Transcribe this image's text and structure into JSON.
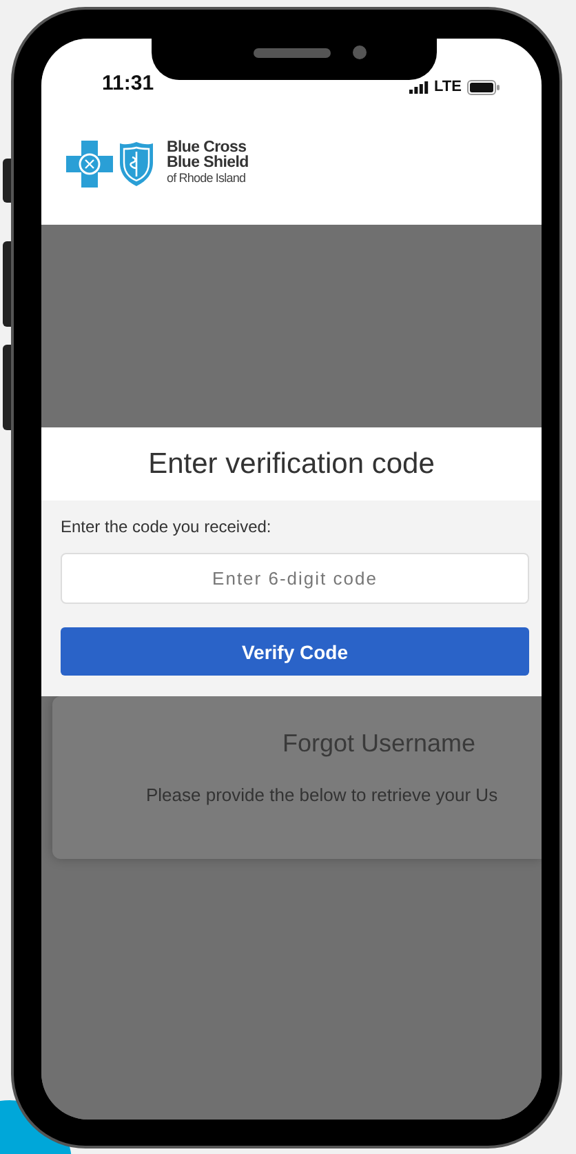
{
  "status_bar": {
    "time": "11:31",
    "network": "LTE"
  },
  "header": {
    "logo_lines": [
      "Blue Cross",
      "Blue Shield",
      "of Rhode Island"
    ]
  },
  "modal": {
    "title": "Enter verification code",
    "prompt": "Enter the code you received:",
    "code_field": {
      "placeholder": "Enter 6-digit code"
    },
    "verify_button": "Verify Code"
  },
  "background_card": {
    "title": "Forgot Username",
    "text": "Please provide the below to retrieve your Us"
  }
}
